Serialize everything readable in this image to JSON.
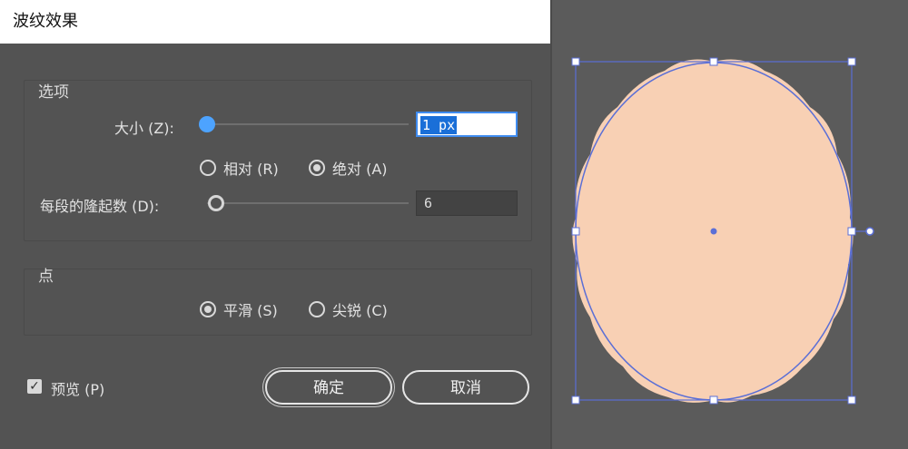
{
  "dialog": {
    "title": "波纹效果",
    "options_group": {
      "label": "选项",
      "size_label": "大小 (Z):",
      "size_value": "1 px",
      "relative_label": "相对 (R)",
      "absolute_label": "绝对 (A)",
      "ridges_label": "每段的隆起数 (D):",
      "ridges_value": "6"
    },
    "points_group": {
      "label": "点",
      "smooth_label": "平滑 (S)",
      "corner_label": "尖锐 (C)"
    },
    "preview_label": "预览 (P)",
    "ok_label": "确定",
    "cancel_label": "取消"
  },
  "colors": {
    "shape_fill": "#f8d0b4",
    "selection": "#5b6fd6"
  }
}
